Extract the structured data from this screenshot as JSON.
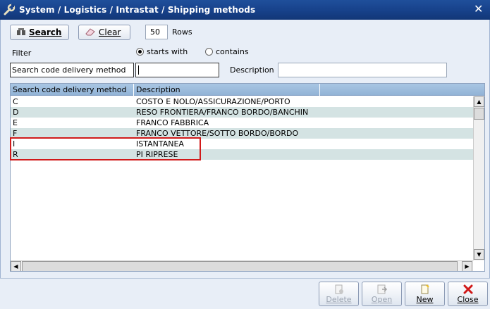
{
  "window": {
    "title": "System / Logistics / Intrastat / Shipping methods",
    "close_glyph": "✕"
  },
  "toolbar": {
    "search_label": "Search",
    "clear_label": "Clear",
    "rows_value": "50",
    "rows_label": "Rows"
  },
  "filter": {
    "label": "Filter",
    "starts_with": "starts with",
    "contains": "contains",
    "selected": "starts_with",
    "code_label": "Search code delivery method",
    "code_value": "",
    "description_label": "Description",
    "description_value": ""
  },
  "grid": {
    "columns": [
      "Search code delivery method",
      "Description",
      ""
    ],
    "rows": [
      {
        "code": "C",
        "description": "COSTO E NOLO/ASSICURAZIONE/PORTO"
      },
      {
        "code": "D",
        "description": "RESO FRONTIERA/FRANCO BORDO/BANCHIN"
      },
      {
        "code": "E",
        "description": "FRANCO FABBRICA"
      },
      {
        "code": "F",
        "description": "FRANCO VETTORE/SOTTO BORDO/BORDO"
      },
      {
        "code": "I",
        "description": "ISTANTANEA"
      },
      {
        "code": "R",
        "description": "PI RIPRESE"
      }
    ]
  },
  "actions": {
    "delete_label": "Delete",
    "open_label": "Open",
    "new_label": "New",
    "close_label": "Close"
  },
  "colors": {
    "title_bar": "#17418a",
    "highlight": "#d11a1a",
    "alt_row": "#d4e3e3",
    "header": "#a9c6e3"
  }
}
